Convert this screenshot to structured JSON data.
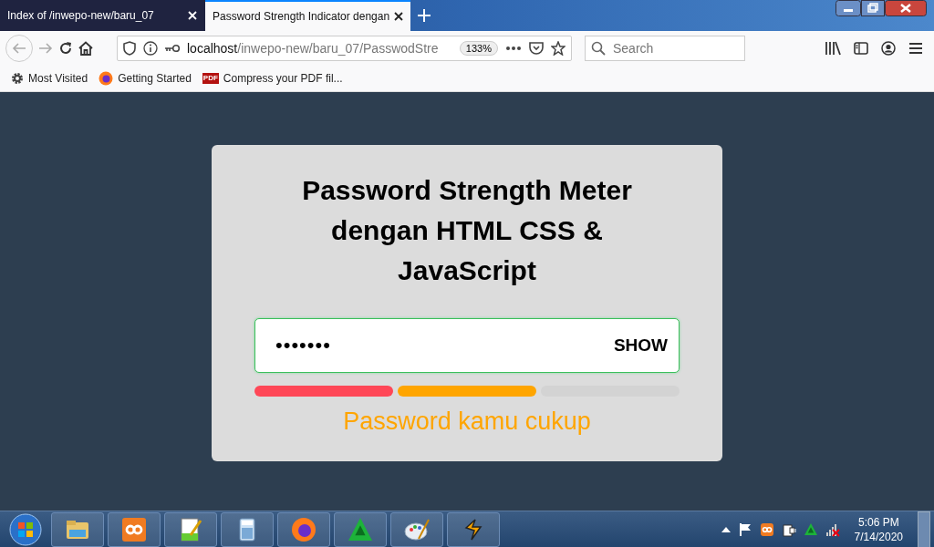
{
  "tabs": [
    {
      "title": "Index of /inwepo-new/baru_07",
      "selected": false
    },
    {
      "title": "Password Strength Indicator dengan",
      "selected": true
    }
  ],
  "nav": {
    "url_host": "localhost",
    "url_path": "/inwepo-new/baru_07/PasswodStre",
    "zoom": "133%",
    "search": {
      "placeholder": "Search"
    }
  },
  "bookmarks": [
    {
      "label": "Most Visited",
      "kind": "gear"
    },
    {
      "label": "Getting Started",
      "kind": "firefox"
    },
    {
      "label": "Compress your PDF fil...",
      "kind": "pdf",
      "icon_text": "PDF"
    }
  ],
  "card": {
    "title": "Password Strength Meter dengan HTML CSS & JavaScript",
    "password": {
      "value": "•••••••",
      "toggle": "SHOW"
    },
    "segments": [
      {
        "color": "#ff4757"
      },
      {
        "color": "#ffa500"
      },
      {
        "color": "#d3d3d3"
      }
    ],
    "message": "Password kamu cukup"
  },
  "taskbar": {
    "apps": [
      {
        "kind": "folder"
      },
      {
        "kind": "xampp"
      },
      {
        "kind": "notepad"
      },
      {
        "kind": "calculator"
      },
      {
        "kind": "firefox"
      },
      {
        "kind": "triangle"
      },
      {
        "kind": "paint"
      },
      {
        "kind": "winamp"
      }
    ],
    "tray": [
      {
        "kind": "arrow"
      },
      {
        "kind": "flag"
      },
      {
        "kind": "xampp"
      },
      {
        "kind": "power"
      },
      {
        "kind": "triangle"
      },
      {
        "kind": "signal"
      }
    ],
    "time": "5:06 PM",
    "date": "7/14/2020"
  }
}
